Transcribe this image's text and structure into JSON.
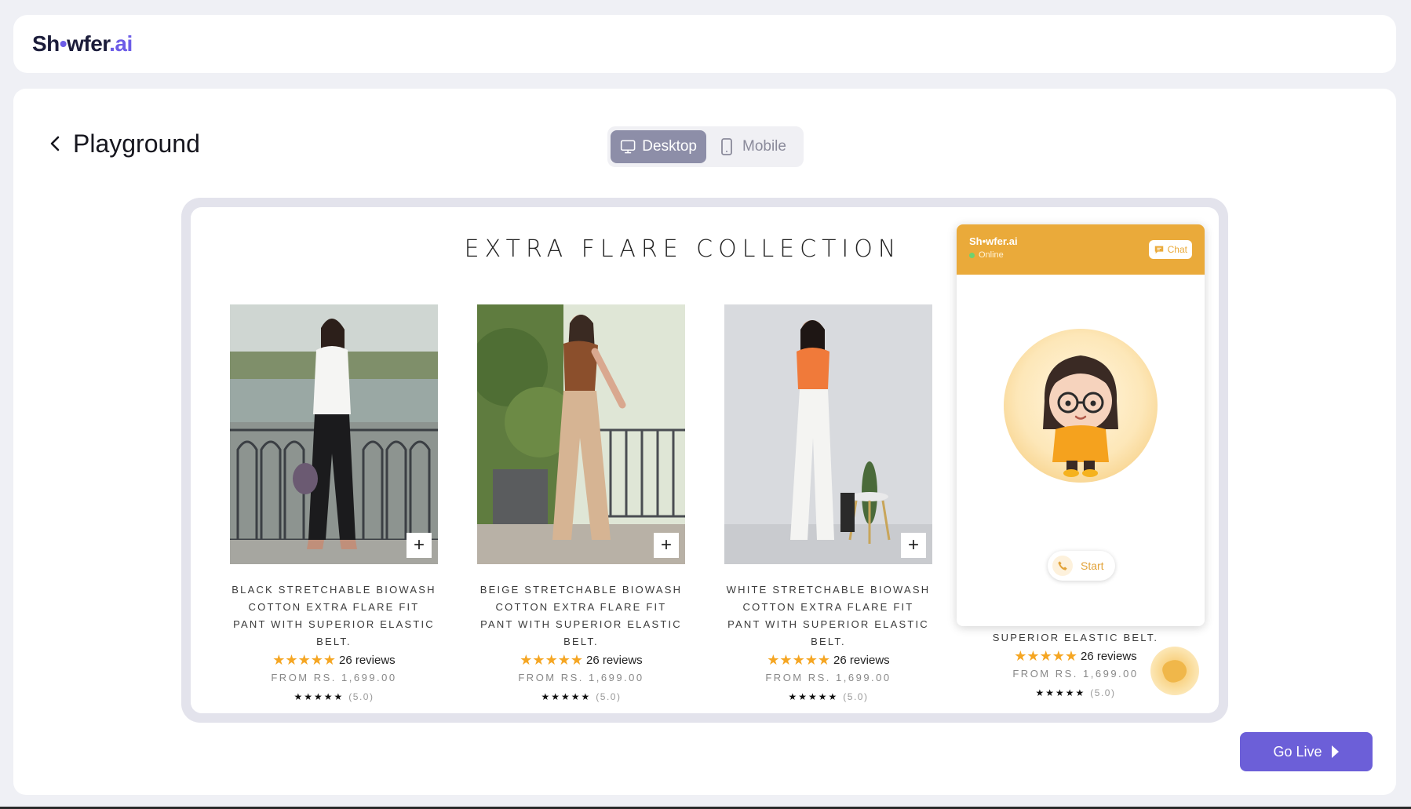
{
  "header": {
    "logo_text_a": "Sh",
    "logo_text_b": "wfer",
    "logo_text_c": ".ai"
  },
  "page": {
    "title": "Playground"
  },
  "view_toggle": {
    "options": [
      {
        "label": "Desktop",
        "active": true
      },
      {
        "label": "Mobile",
        "active": false
      }
    ]
  },
  "preview": {
    "collection_title": "EXTRA FLARE COLLECTION",
    "products": [
      {
        "name": "BLACK STRETCHABLE BIOWASH COTTON EXTRA FLARE FIT PANT WITH SUPERIOR ELASTIC BELT.",
        "stars": "★★★★★",
        "reviews": "26 reviews",
        "price": "FROM RS. 1,699.00",
        "mini_stars": "★★★★★",
        "score": "(5.0)"
      },
      {
        "name": "BEIGE STRETCHABLE BIOWASH COTTON EXTRA FLARE FIT PANT WITH SUPERIOR ELASTIC BELT.",
        "stars": "★★★★★",
        "reviews": "26 reviews",
        "price": "FROM RS. 1,699.00",
        "mini_stars": "★★★★★",
        "score": "(5.0)"
      },
      {
        "name": "WHITE STRETCHABLE BIOWASH COTTON EXTRA FLARE FIT PANT WITH SUPERIOR ELASTIC BELT.",
        "stars": "★★★★★",
        "reviews": "26 reviews",
        "price": "FROM RS. 1,699.00",
        "mini_stars": "★★★★★",
        "score": "(5.0)"
      },
      {
        "name": "SUPERIOR ELASTIC BELT.",
        "stars": "★★★★★",
        "reviews": "26 reviews",
        "price": "FROM RS. 1,699.00",
        "mini_stars": "★★★★★",
        "score": "(5.0)"
      }
    ]
  },
  "chat_widget": {
    "brand": "Sh•wfer.ai",
    "status": "Online",
    "chat_label": "Chat",
    "start_label": "Start",
    "accent": "#EAAA3A"
  },
  "actions": {
    "go_live": "Go Live"
  },
  "colors": {
    "primary": "#6C5FD8",
    "background": "#EFF0F5",
    "toggle_active": "#8D8EA8"
  }
}
